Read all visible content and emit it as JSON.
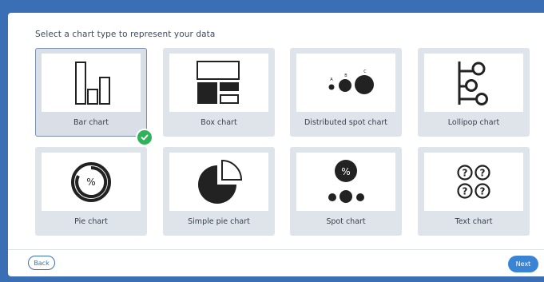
{
  "dialog": {
    "heading": "Select a chart type to represent your data",
    "selected_chart": "Bar chart"
  },
  "charts": [
    {
      "label": "Bar chart",
      "icon": "bar-chart-icon"
    },
    {
      "label": "Box chart",
      "icon": "box-chart-icon"
    },
    {
      "label": "Distributed spot chart",
      "icon": "distributed-spot-chart-icon",
      "sub_labels": [
        "A",
        "B",
        "C"
      ]
    },
    {
      "label": "Lollipop chart",
      "icon": "lollipop-chart-icon"
    },
    {
      "label": "Pie chart",
      "icon": "pie-chart-icon",
      "symbol": "%"
    },
    {
      "label": "Simple pie chart",
      "icon": "simple-pie-chart-icon"
    },
    {
      "label": "Spot chart",
      "icon": "spot-chart-icon",
      "symbol": "%"
    },
    {
      "label": "Text chart",
      "icon": "text-chart-icon",
      "symbol": "?"
    }
  ],
  "footer": {
    "back_label": "Back",
    "next_label": "Next"
  },
  "colors": {
    "accent": "#3a84d6",
    "outer_background": "#3a6fb5",
    "card_background": "#dfe3ea",
    "icon": "#222222",
    "check": "#2fb35a"
  }
}
